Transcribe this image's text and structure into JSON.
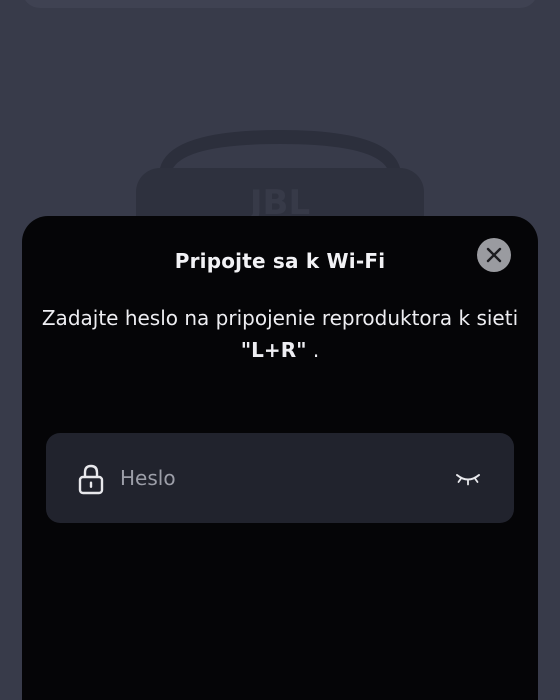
{
  "dialog": {
    "title": "Pripojte sa k Wi-Fi",
    "message_prefix": "Zadajte heslo na pripojenie reproduktora k sieti ",
    "network_name": "\"L+R\"",
    "message_suffix": " ."
  },
  "password": {
    "placeholder": "Heslo",
    "value": ""
  },
  "background": {
    "brand_text": "JBL"
  },
  "icons": {
    "close": "close-icon",
    "lock": "lock-icon",
    "visibility": "eye-closed-icon"
  },
  "colors": {
    "backdrop": "#383b4a",
    "sheet": "#050507",
    "field": "#21232d",
    "close_button": "#9a9ba0"
  }
}
